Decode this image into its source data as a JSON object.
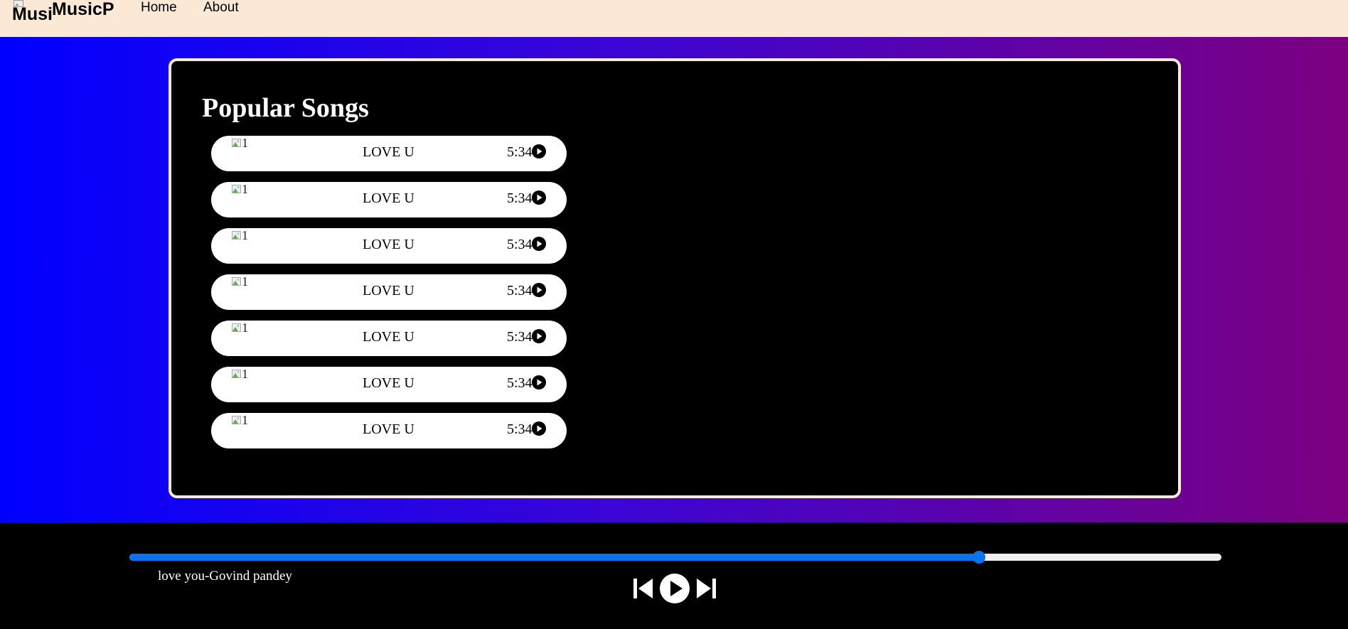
{
  "nav": {
    "logo_alt": "MusicP",
    "brand": "MusicP",
    "links": [
      "Home",
      "About"
    ]
  },
  "main": {
    "heading": "Popular Songs",
    "songs": [
      {
        "img_alt": "1",
        "title": "LOVE U",
        "duration": "5:34",
        "icon": "play-icon"
      },
      {
        "img_alt": "1",
        "title": "LOVE U",
        "duration": "5:34",
        "icon": "play-icon"
      },
      {
        "img_alt": "1",
        "title": "LOVE U",
        "duration": "5:34",
        "icon": "play-icon"
      },
      {
        "img_alt": "1",
        "title": "LOVE U",
        "duration": "5:34",
        "icon": "play-icon"
      },
      {
        "img_alt": "1",
        "title": "LOVE U",
        "duration": "5:34",
        "icon": "play-icon"
      },
      {
        "img_alt": "1",
        "title": "LOVE U",
        "duration": "5:34",
        "icon": "play-icon"
      },
      {
        "img_alt": "1",
        "title": "LOVE U",
        "duration": "5:34",
        "icon": "play-icon"
      }
    ]
  },
  "player": {
    "progress_fraction": 0.778,
    "now_playing": "love you-Govind pandey",
    "controls": [
      "previous-icon",
      "play-icon",
      "next-icon"
    ]
  },
  "colors": {
    "nav_bg": "#fbe9d6",
    "gradient_start": "#0000ff",
    "gradient_end": "#7d0080",
    "panel_border": "#f7ebdc",
    "accent": "#0a74ef"
  }
}
